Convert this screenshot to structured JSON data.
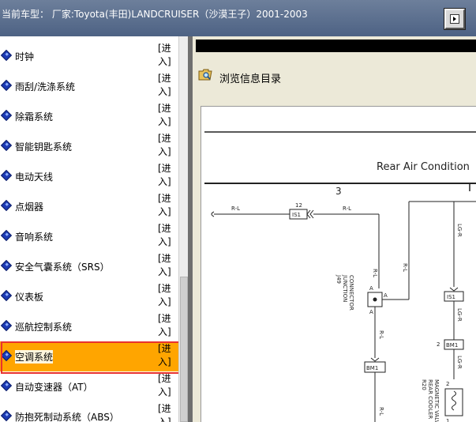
{
  "header": {
    "title": "当前车型：  厂家:Toyota(丰田)LANDCRUISER（沙漠王子）2001-2003"
  },
  "systems": [
    {
      "label": "时钟",
      "enter": "[进入]"
    },
    {
      "label": "雨刮/洗涤系统",
      "enter": "[进入]"
    },
    {
      "label": "除霜系统",
      "enter": "[进入]"
    },
    {
      "label": "智能钥匙系统",
      "enter": "[进入]"
    },
    {
      "label": "电动天线",
      "enter": "[进入]"
    },
    {
      "label": "点烟器",
      "enter": "[进入]"
    },
    {
      "label": "音响系统",
      "enter": "[进入]"
    },
    {
      "label": "安全气囊系统（SRS）",
      "enter": "[进入]"
    },
    {
      "label": "仪表板",
      "enter": "[进入]"
    },
    {
      "label": "巡航控制系统",
      "enter": "[进入]"
    },
    {
      "label": "空调系统",
      "enter": "[进入]"
    },
    {
      "label": "自动变速器（AT）",
      "enter": "[进入]"
    },
    {
      "label": "防抱死制动系统（ABS）",
      "enter": "[进入]"
    }
  ],
  "selected_index": 10,
  "browse": {
    "label": "浏览信息目录",
    "icon": "folder-search-icon"
  },
  "diagram": {
    "heading": "Rear Air Condition",
    "section_number": "3",
    "wire_rl": "R-L",
    "wire_lgr": "LG-R",
    "pin_12": "12",
    "pin_2": "2",
    "pin_1": "1",
    "pin_a": "A",
    "connector_is1": "IS1",
    "connector_bm1": "BM1",
    "junction_id": "J49",
    "junction_name1": "JUNCTION",
    "junction_name2": "CONNECTOR",
    "valve_id": "R20",
    "valve_name1": "REAR COOLER",
    "valve_name2": "MAGNETIC VALVE"
  },
  "colors": {
    "title_bar": "#5a6e8f",
    "selected": "#ffa500",
    "highlight_border": "#e8322e",
    "panel": "#ece9d8"
  }
}
